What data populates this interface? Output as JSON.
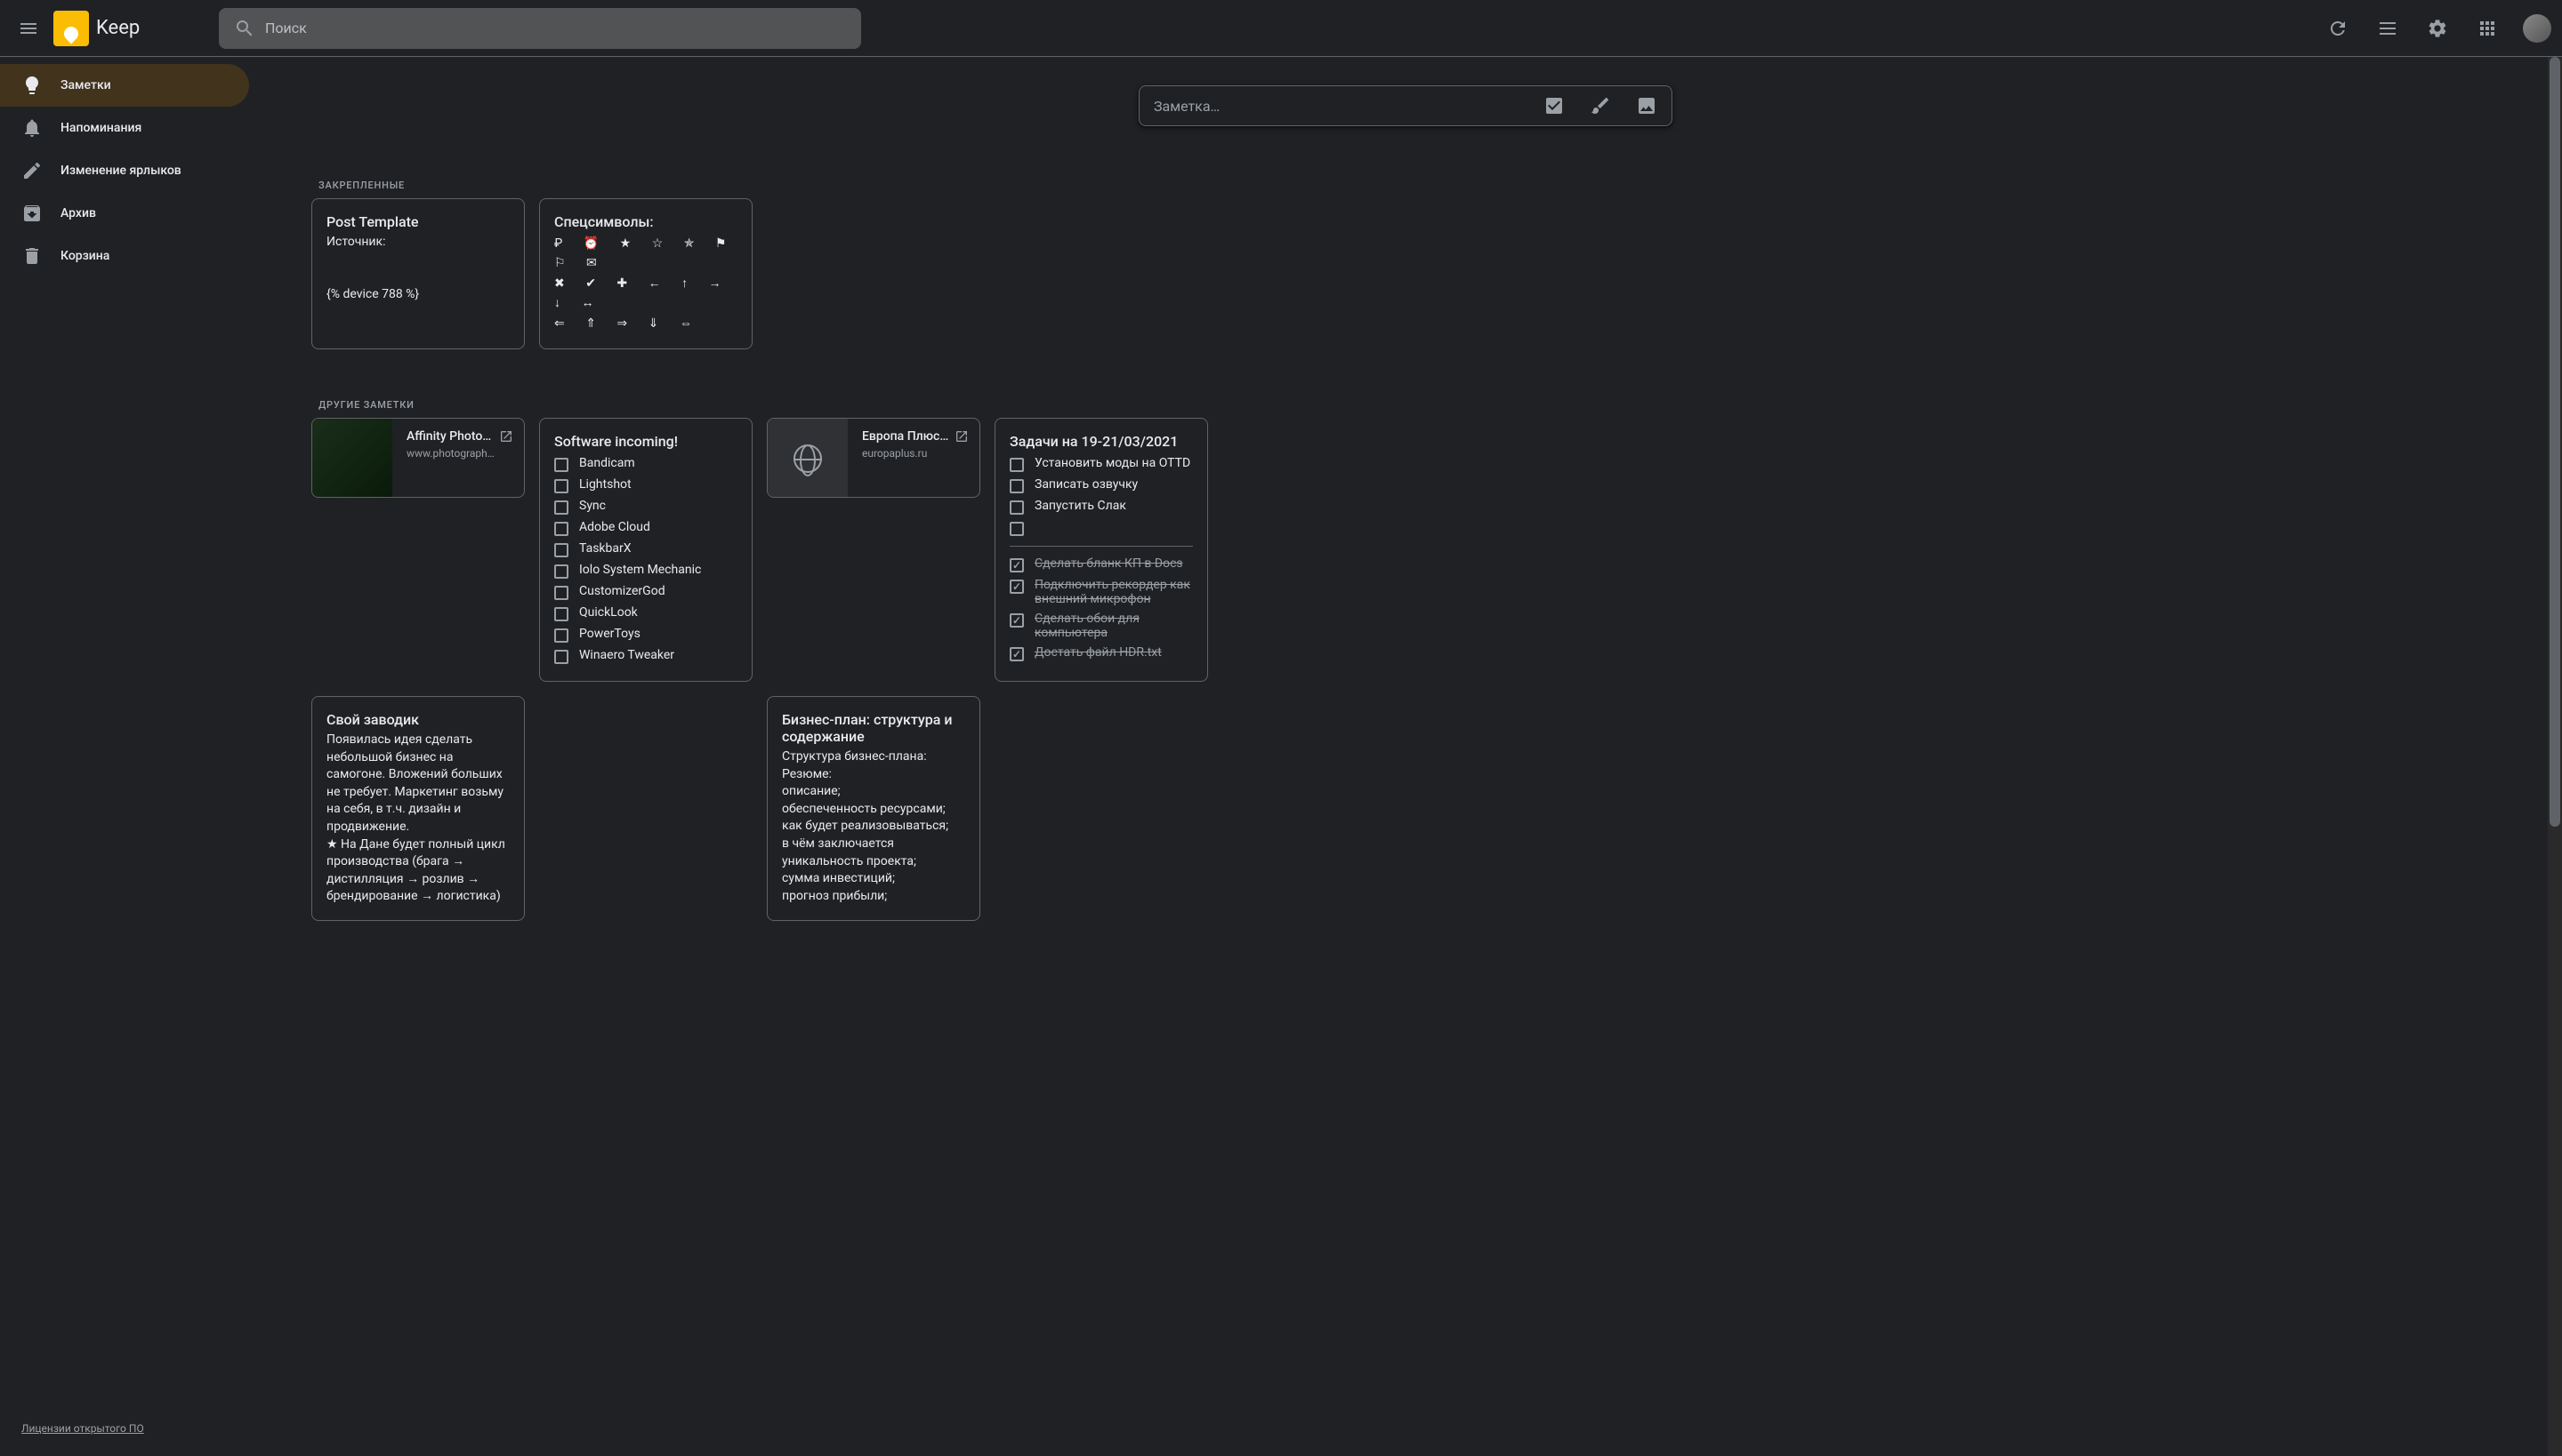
{
  "header": {
    "app_name": "Keep",
    "search_placeholder": "Поиск"
  },
  "sidebar": {
    "items": [
      {
        "label": "Заметки",
        "active": true,
        "icon": "lightbulb"
      },
      {
        "label": "Напоминания",
        "active": false,
        "icon": "bell"
      },
      {
        "label": "Изменение ярлыков",
        "active": false,
        "icon": "pencil"
      },
      {
        "label": "Архив",
        "active": false,
        "icon": "archive"
      },
      {
        "label": "Корзина",
        "active": false,
        "icon": "trash"
      }
    ],
    "license_label": "Лицензии открытого ПО"
  },
  "new_note": {
    "placeholder": "Заметка…"
  },
  "sections": {
    "pinned_label": "ЗАКРЕПЛЕННЫЕ",
    "others_label": "ДРУГИЕ ЗАМЕТКИ"
  },
  "pinned_notes": [
    {
      "title": "Post Template",
      "body": "Источник:\n\n\n{% device 788 %}"
    },
    {
      "title": "Спецсимволы:",
      "symbols_row1": "₽ ⏰ ★ ☆ ✯ ⚑ ⚐ ✉",
      "symbols_row2": "✖ ✔ ✚ ← ↑ → ↓ ↔",
      "symbols_row3": "⇐ ⇑ ⇒ ⇓ ⇔"
    }
  ],
  "other_notes": {
    "link_cards": [
      {
        "title": "Affinity Photo…",
        "url": "www.photograph…"
      },
      {
        "title": "Европа Плюс…",
        "url": "europaplus.ru"
      }
    ],
    "software_note": {
      "title": "Software incoming!",
      "items": [
        "Bandicam",
        "Lightshot",
        "Sync",
        "Adobe Cloud",
        "TaskbarX",
        "Iolo System Mechanic",
        "CustomizerGod",
        "QuickLook",
        "PowerToys",
        "Winaero Tweaker"
      ]
    },
    "zavod_note": {
      "title": "Свой заводик",
      "body": "Появилась идея сделать небольшой бизнес на самогоне. Вложений больших не требует. Маркетинг возьму на себя, в т.ч. дизайн и продвижение.\n★ На Дане будет полный цикл производства (брага → дистилляция → розлив → брендирование → логистика)"
    },
    "biznes_note": {
      "title": "Бизнес-план: структура и содержание",
      "body": "Структура бизнес-плана:\nРезюме:\nописание;\nобеспеченность ресурсами;\nкак будет реализовываться;\nв чём заключается уникальность проекта;\nсумма инвестиций;\nпрогноз прибыли;"
    },
    "tasks_note": {
      "title": "Задачи на 19-21/03/2021",
      "unchecked": [
        "Установить моды на OTTD",
        "Записать озвучку",
        "Запустить Слак",
        ""
      ],
      "checked": [
        "Сделать бланк КП в Docs",
        "Подключить рекордер как внешний микрофон",
        "Сделать обои для компьютера",
        "Достать файл HDR.txt"
      ]
    }
  }
}
